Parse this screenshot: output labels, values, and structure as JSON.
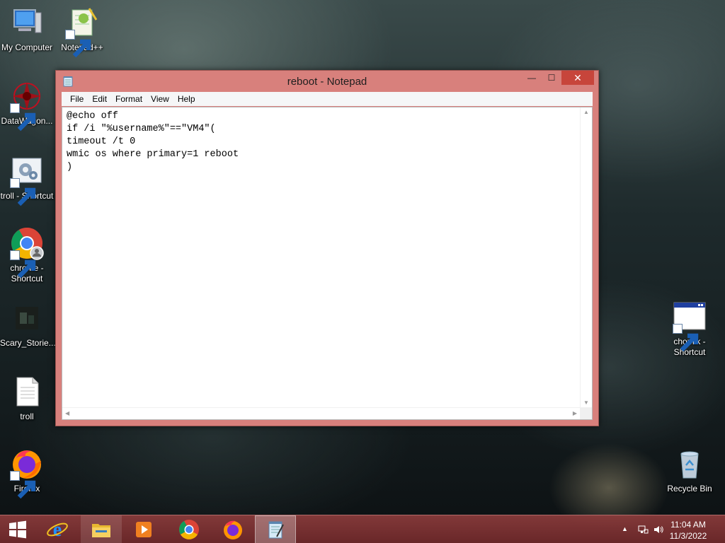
{
  "desktop": {
    "icons_left": [
      {
        "name": "my-computer-icon",
        "label": "My Computer"
      },
      {
        "name": "notepadpp-icon",
        "label": "Notepad++"
      },
      {
        "name": "datawagon-icon",
        "label": "DataWagon..."
      },
      {
        "name": "troll-shortcut-icon",
        "label": "troll - Shortcut"
      },
      {
        "name": "chrome-shortcut-icon",
        "label": "chrome - Shortcut"
      },
      {
        "name": "scary-stories-icon",
        "label": "Scary_Storie..."
      },
      {
        "name": "troll-file-icon",
        "label": "troll"
      },
      {
        "name": "firefox-icon",
        "label": "Firefox"
      }
    ],
    "icons_right": [
      {
        "name": "chomik-shortcut-icon",
        "label": "chomik - Shortcut"
      },
      {
        "name": "recycle-bin-icon",
        "label": "Recycle Bin"
      }
    ]
  },
  "window": {
    "title": "reboot - Notepad",
    "controls": {
      "minimize": "—",
      "maximize": "☐",
      "close": "✕"
    },
    "menu": [
      "File",
      "Edit",
      "Format",
      "View",
      "Help"
    ],
    "content": "@echo off\nif /i \"%username%\"==\"VM4\"(\ntimeout /t 0\nwmic os where primary=1 reboot\n)"
  },
  "taskbar": {
    "items": [
      "start-button",
      "internet-explorer",
      "file-explorer",
      "media-player",
      "chrome",
      "firefox",
      "notepad"
    ],
    "active": "notepad",
    "clock": {
      "time": "11:04 AM",
      "date": "11/3/2022"
    }
  },
  "colors": {
    "window_frame": "#d8807c",
    "taskbar": "#8c3c3c",
    "close_button": "#c7453b"
  }
}
